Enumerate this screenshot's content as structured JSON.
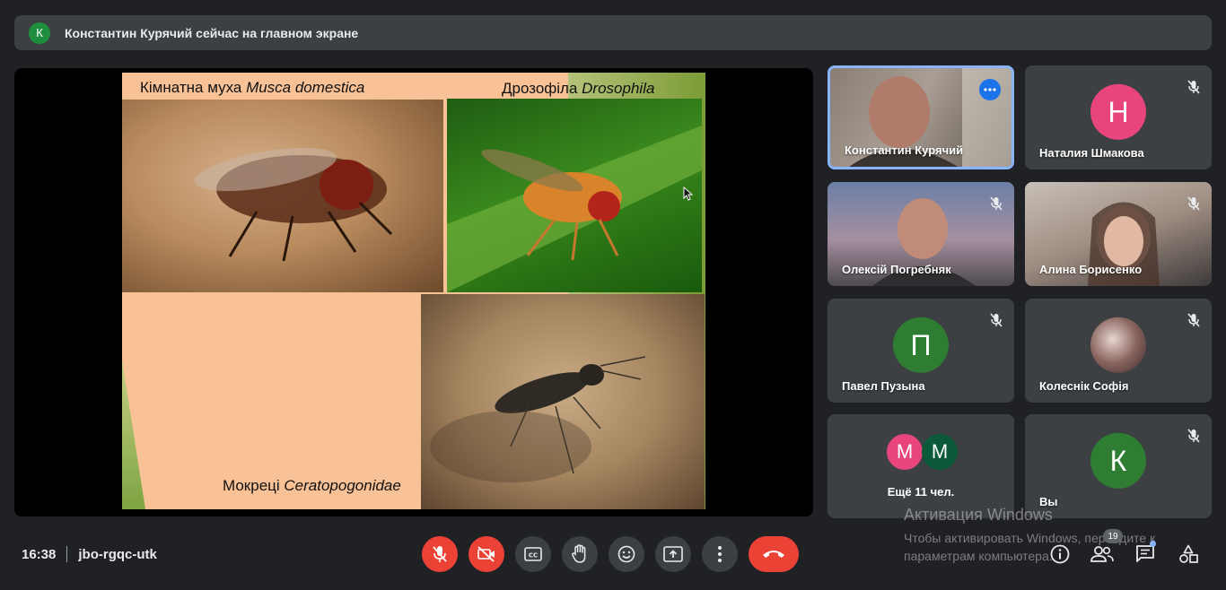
{
  "banner": {
    "avatar_letter": "К",
    "text": "Константин Курячий сейчас на главном экране"
  },
  "slide": {
    "caption_housefly_prefix": "Кімнатна муха ",
    "caption_housefly_latin": "Musca domestica",
    "caption_drosophila_prefix": "Дрозофіла ",
    "caption_drosophila_latin": "Drosophila",
    "caption_midges_prefix": "Мокреці ",
    "caption_midges_latin": "Ceratopogonidae"
  },
  "participants": [
    {
      "name": "Константин Курячий",
      "type": "video",
      "speaking": true
    },
    {
      "name": "Наталия Шмакова",
      "type": "avatar",
      "letter": "Н",
      "color": "#e8457d",
      "muted": true
    },
    {
      "name": "Олексій Погребняк",
      "type": "video",
      "muted": true
    },
    {
      "name": "Алина Борисенко",
      "type": "video",
      "muted": true
    },
    {
      "name": "Павел Пузына",
      "type": "avatar",
      "letter": "П",
      "color": "#2e7d32",
      "muted": true
    },
    {
      "name": "Колеснік Софія",
      "type": "photo",
      "muted": true
    },
    {
      "name": "Ещё 11 чел.",
      "type": "more",
      "letters": [
        "М",
        "М"
      ],
      "colors": [
        "#e8457d",
        "#0b5a3a"
      ]
    },
    {
      "name": "Вы",
      "type": "avatar",
      "letter": "К",
      "color": "#2e7d32",
      "muted": true
    }
  ],
  "meeting": {
    "time": "16:38",
    "code": "jbo-rgqc-utk"
  },
  "controls": [
    "mic-off",
    "camera-off",
    "captions",
    "raise-hand",
    "emoji",
    "present",
    "more-options",
    "leave-call"
  ],
  "right_controls": {
    "participants_count": "19"
  },
  "watermark": {
    "title": "Активация Windows",
    "line1": "Чтобы активировать Windows, перейдите к",
    "line2": "параметрам компьютера."
  }
}
